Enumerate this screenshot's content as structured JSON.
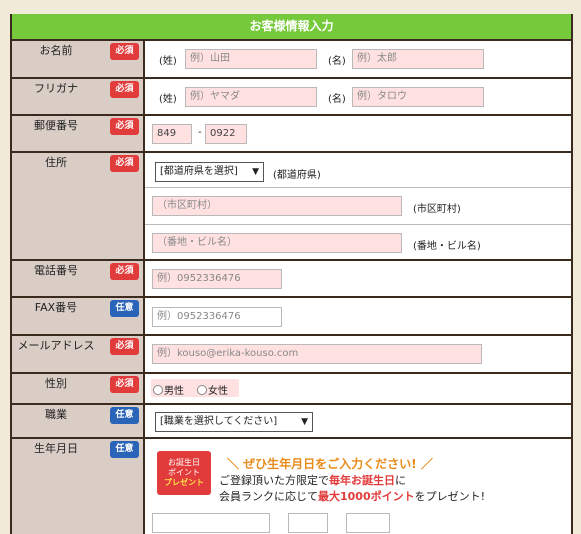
{
  "form": {
    "title": "お客様情報入力",
    "badge_required": "必須",
    "badge_optional": "任意",
    "name": {
      "label": "お名前",
      "sei_label": "(姓)",
      "sei_placeholder": "例）山田",
      "mei_label": "(名)",
      "mei_placeholder": "例）太郎"
    },
    "kana": {
      "label": "フリガナ",
      "sei_label": "(姓)",
      "sei_placeholder": "例）ヤマダ",
      "mei_label": "(名)",
      "mei_placeholder": "例）タロウ"
    },
    "zip": {
      "label": "郵便番号",
      "part1": "849",
      "separator": "-",
      "part2": "0922"
    },
    "address": {
      "label": "住所",
      "pref_select": "[都道府県を選択]",
      "pref_suffix": "(都道府県)",
      "city_placeholder": "（市区町村）",
      "city_suffix": "(市区町村)",
      "street_placeholder": "（番地・ビル名）",
      "street_suffix": "(番地・ビル名)"
    },
    "phone": {
      "label": "電話番号",
      "placeholder": "例）0952336476"
    },
    "fax": {
      "label": "FAX番号",
      "placeholder": "例）0952336476"
    },
    "email": {
      "label": "メールアドレス",
      "placeholder": "例）kouso@erika-kouso.com"
    },
    "gender": {
      "label": "性別",
      "male": "男性",
      "female": "女性"
    },
    "job": {
      "label": "職業",
      "select": "[職業を選択してください]"
    },
    "birthday": {
      "label": "生年月日",
      "gift_line1": "お誕生日",
      "gift_line2": "ポイント",
      "gift_line3": "プレゼント",
      "promo_title": "＼ ぜひ生年月日をご入力ください! ／",
      "promo_line1_a": "ご登録頂いた方限定で",
      "promo_line1_b": "毎年お誕生日",
      "promo_line1_c": "に",
      "promo_line2_a": "会員ランクに応じて",
      "promo_line2_b": "最大1000ポイント",
      "promo_line2_c": "をプレゼント!"
    }
  },
  "colors": {
    "header": "#77c93c",
    "required": "#e23b3b",
    "optional": "#2a64b8",
    "label_bg": "#d9cdc6",
    "input_pink": "#ffe1e1",
    "border": "#3b2a1e"
  }
}
